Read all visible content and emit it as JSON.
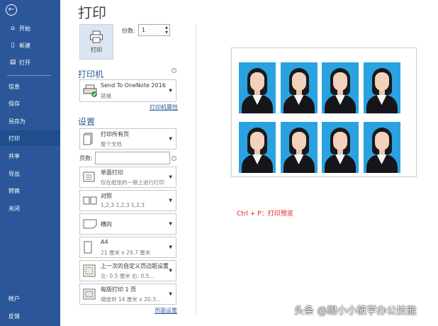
{
  "sidebar": {
    "back_icon": "arrow-left-icon",
    "items": [
      {
        "label": "开始",
        "icon": "home-icon"
      },
      {
        "label": "新建",
        "icon": "new-document-icon"
      },
      {
        "label": "打开",
        "icon": "folder-open-icon"
      },
      {
        "label": "信息"
      },
      {
        "label": "保存"
      },
      {
        "label": "另存为"
      },
      {
        "label": "打印",
        "active": true
      },
      {
        "label": "共享"
      },
      {
        "label": "导出"
      },
      {
        "label": "转换"
      },
      {
        "label": "关闭"
      },
      {
        "label": "帐户"
      },
      {
        "label": "反馈"
      }
    ]
  },
  "main": {
    "title": "打印",
    "print_button": "打印",
    "copies_label": "份数:",
    "copies_value": "1",
    "printer_heading": "打印机",
    "printer": {
      "name": "Send To OneNote 2016",
      "status": "就绪"
    },
    "printer_properties": "打印机属性",
    "settings_heading": "设置",
    "settings": [
      {
        "title": "打印所有页",
        "subtitle": "整个文档"
      },
      {
        "title": "单面打印",
        "subtitle": "仅在纸张的一侧上进行打印"
      },
      {
        "title": "对照",
        "subtitle": "1,2,3    1,2,3    1,2,3"
      },
      {
        "title": "横向",
        "subtitle": ""
      },
      {
        "title": "A4",
        "subtitle": "21 厘米 x 29.7 厘米"
      },
      {
        "title": "上一次的自定义页边距设置",
        "subtitle": "左:  0.5 厘米    右:  0.5..."
      },
      {
        "title": "每版打印 1 页",
        "subtitle": "缩放到 14 厘米 x 20.3..."
      }
    ],
    "pages_label": "页数:",
    "pages_value": "",
    "page_setup_link": "页面设置"
  },
  "preview": {
    "photo_rows": 2,
    "photo_cols": 4,
    "background_color": "#2aa2e2"
  },
  "annotation": "Ctrl + P：打印预览",
  "watermark": "头条 @跟小小筱学办公技能",
  "colors": {
    "sidebar": "#2b579a",
    "active_item": "#1e4e8c",
    "accent": "#2b579a",
    "annotation": "#e02020"
  }
}
